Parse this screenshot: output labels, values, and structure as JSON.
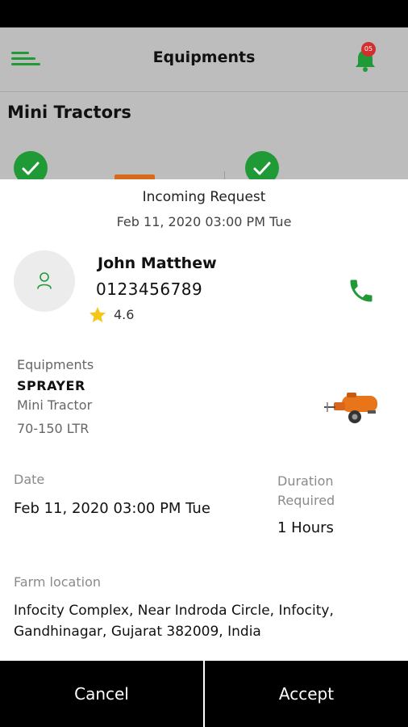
{
  "header": {
    "title": "Equipments",
    "notification_count": "05",
    "accent_color": "#1f9a37"
  },
  "background": {
    "section_title": "Mini Tractors"
  },
  "request": {
    "title": "Incoming Request",
    "datetime": "Feb 11, 2020 03:00 PM Tue"
  },
  "user": {
    "name": "John Matthew",
    "phone": "0123456789",
    "rating": "4.6",
    "avatar_icon": "person-icon",
    "call_icon": "phone-icon"
  },
  "equipment": {
    "label": "Equipments",
    "name": "SPRAYER",
    "type": "Mini Tractor",
    "capacity": "70-150 LTR"
  },
  "schedule": {
    "date_label": "Date",
    "date_value": "Feb 11, 2020 03:00 PM Tue",
    "duration_label": "Duration Required",
    "duration_value": "1 Hours"
  },
  "location": {
    "label": "Farm location",
    "address": "Infocity Complex, Near Indroda Circle, Infocity, Gandhinagar, Gujarat 382009, India"
  },
  "actions": {
    "cancel_label": "Cancel",
    "accept_label": "Accept"
  }
}
